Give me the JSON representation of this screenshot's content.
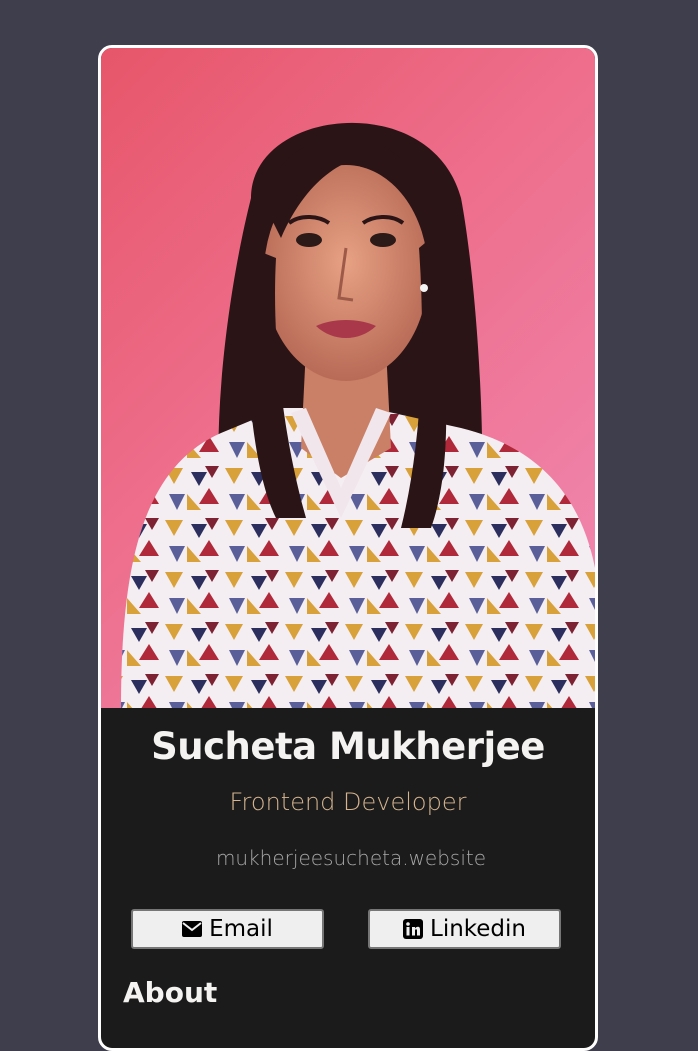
{
  "profile": {
    "name": "Sucheta Mukherjee",
    "title": "Frontend Developer",
    "website": "mukherjeesucheta.website"
  },
  "buttons": {
    "email_label": "Email",
    "email_icon": "envelope-icon",
    "linkedin_label": "Linkedin",
    "linkedin_icon": "linkedin-icon"
  },
  "sections": {
    "about_heading": "About"
  },
  "colors": {
    "page_background": "#3f3e4c",
    "card_background": "#1b1b1c",
    "card_border": "#ffffff",
    "name_color": "#f4f3f1",
    "title_accent": "#d6b58f",
    "website_color": "#a8a8a8",
    "photo_backdrop": "#ee6f8d"
  }
}
